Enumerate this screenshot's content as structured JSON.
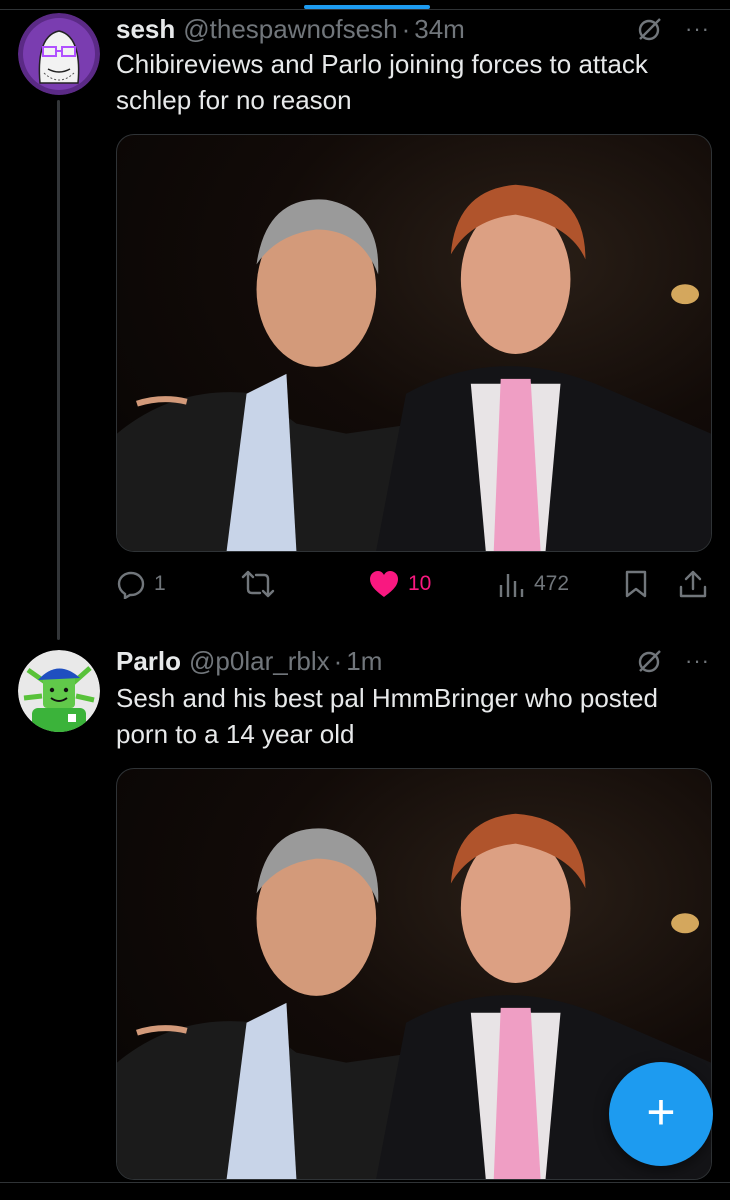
{
  "tweets": [
    {
      "display_name": "sesh",
      "handle": "@thespawnofsesh",
      "dot": "·",
      "time": "34m",
      "text": "Chibireviews and Parlo joining forces to attack schlep for no reason",
      "actions": {
        "replies": "1",
        "likes": "10",
        "views": "472"
      },
      "liked": true
    },
    {
      "display_name": "Parlo",
      "handle": "@p0lar_rblx",
      "dot": "·",
      "time": "1m",
      "text": "Sesh and his best pal HmmBringer who posted porn to a 14 year old"
    }
  ],
  "icons": {
    "grok": "grok-icon",
    "more": "more-icon",
    "reply": "reply-icon",
    "retweet": "retweet-icon",
    "like": "heart-icon",
    "views": "views-icon",
    "bookmark": "bookmark-icon",
    "share": "share-icon",
    "compose": "plus-icon"
  },
  "more_glyph": "···",
  "compose_glyph": "+",
  "colors": {
    "background": "#000000",
    "text": "#e7e9ea",
    "muted": "#71767b",
    "like": "#f91880",
    "accent": "#1d9bf0",
    "border": "#2f3336"
  }
}
